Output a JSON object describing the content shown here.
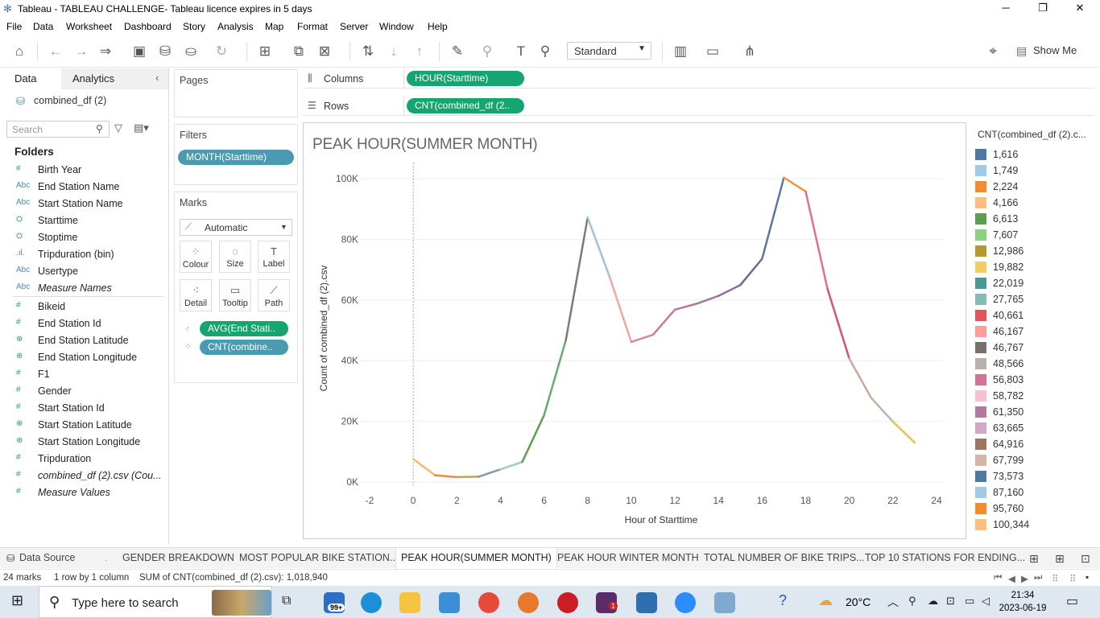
{
  "window": {
    "title": "Tableau - TABLEAU CHALLENGE- Tableau licence expires in 5 days"
  },
  "menu": [
    "File",
    "Data",
    "Worksheet",
    "Dashboard",
    "Story",
    "Analysis",
    "Map",
    "Format",
    "Server",
    "Window",
    "Help"
  ],
  "toolbar": {
    "view_select": "Standard",
    "show_me": "Show Me"
  },
  "datapane": {
    "tab_data": "Data",
    "tab_analytics": "Analytics",
    "datasource": "combined_df (2)",
    "search_placeholder": "Search",
    "folders_label": "Folders",
    "dimensions": [
      {
        "icon": "#",
        "name": "Birth Year"
      },
      {
        "icon": "Abc",
        "name": "End Station Name"
      },
      {
        "icon": "Abc",
        "name": "Start Station Name"
      },
      {
        "icon": "date",
        "name": "Starttime"
      },
      {
        "icon": "date",
        "name": "Stoptime"
      },
      {
        "icon": "bin",
        "name": "Tripduration (bin)"
      },
      {
        "icon": "Abc",
        "name": "Usertype"
      },
      {
        "icon": "Abc",
        "name": "Measure Names"
      }
    ],
    "measures": [
      {
        "icon": "#",
        "name": "Bikeid"
      },
      {
        "icon": "#",
        "name": "End Station Id"
      },
      {
        "icon": "geo",
        "name": "End Station Latitude"
      },
      {
        "icon": "geo",
        "name": "End Station Longitude"
      },
      {
        "icon": "#",
        "name": "F1"
      },
      {
        "icon": "#",
        "name": "Gender"
      },
      {
        "icon": "#",
        "name": "Start Station Id"
      },
      {
        "icon": "geo",
        "name": "Start Station Latitude"
      },
      {
        "icon": "geo",
        "name": "Start Station Longitude"
      },
      {
        "icon": "#",
        "name": "Tripduration"
      },
      {
        "icon": "#",
        "name": "combined_df (2).csv (Cou..."
      },
      {
        "icon": "#",
        "name": "Measure Values"
      }
    ]
  },
  "pages_label": "Pages",
  "filters": {
    "label": "Filters",
    "pill": "MONTH(Starttime)"
  },
  "marks": {
    "label": "Marks",
    "type": "Automatic",
    "buttons": [
      "Colour",
      "Size",
      "Label",
      "Detail",
      "Tooltip",
      "Path"
    ],
    "pills": [
      "AVG(End Stati..",
      "CNT(combine.."
    ]
  },
  "shelves": {
    "columns_label": "Columns",
    "columns_pill": "HOUR(Starttime)",
    "rows_label": "Rows",
    "rows_pill": "CNT(combined_df (2.."
  },
  "chart_data": {
    "type": "line",
    "title": "PEAK HOUR(SUMMER MONTH)",
    "xlabel": "Hour of Starttime",
    "ylabel": "Count of combined_df (2).csv",
    "x_ticks": [
      "-2",
      "0",
      "2",
      "4",
      "6",
      "8",
      "10",
      "12",
      "14",
      "16",
      "18",
      "20",
      "22",
      "24"
    ],
    "y_ticks": [
      "0K",
      "20K",
      "40K",
      "60K",
      "80K",
      "100K"
    ],
    "xlim": [
      -2,
      24
    ],
    "ylim": [
      0,
      100000
    ],
    "x": [
      0,
      1,
      2,
      3,
      4,
      5,
      6,
      7,
      8,
      9,
      10,
      11,
      12,
      13,
      14,
      15,
      16,
      17,
      18,
      19,
      20,
      21,
      22,
      23
    ],
    "y": [
      7607,
      2224,
      1616,
      1749,
      4166,
      6613,
      22019,
      46767,
      87160,
      67799,
      46167,
      48566,
      56803,
      58782,
      61350,
      64916,
      73573,
      100344,
      95760,
      63665,
      40661,
      27765,
      19882,
      12986
    ],
    "segment_colors": [
      "#f5b96e",
      "#eb8f2f",
      "#c9a24a",
      "#7f9aa6",
      "#9fcdb8",
      "#5d9e4f",
      "#6aa876",
      "#7a7a7a",
      "#9fc2dd",
      "#f2a6a0",
      "#d18aa0",
      "#c77a9c",
      "#b5789a",
      "#a67aa0",
      "#8e7296",
      "#6a6a8e",
      "#5b77a6",
      "#f39440",
      "#e0708c",
      "#d6517a",
      "#c9a8a4",
      "#a8c0a0",
      "#e3c44f"
    ],
    "grid": true
  },
  "legend": {
    "title": "CNT(combined_df (2).c...",
    "items": [
      {
        "value": "1,616",
        "color": "#4e79a7"
      },
      {
        "value": "1,749",
        "color": "#a0cbe8"
      },
      {
        "value": "2,224",
        "color": "#f28e2b"
      },
      {
        "value": "4,166",
        "color": "#ffbe7d"
      },
      {
        "value": "6,613",
        "color": "#59a14f"
      },
      {
        "value": "7,607",
        "color": "#8cd17d"
      },
      {
        "value": "12,986",
        "color": "#b6992d"
      },
      {
        "value": "19,882",
        "color": "#f1ce63"
      },
      {
        "value": "22,019",
        "color": "#499894"
      },
      {
        "value": "27,765",
        "color": "#86bcb6"
      },
      {
        "value": "40,661",
        "color": "#e15759"
      },
      {
        "value": "46,167",
        "color": "#ff9d9a"
      },
      {
        "value": "46,767",
        "color": "#79706e"
      },
      {
        "value": "48,566",
        "color": "#bab0ac"
      },
      {
        "value": "56,803",
        "color": "#d37295"
      },
      {
        "value": "58,782",
        "color": "#fabfd2"
      },
      {
        "value": "61,350",
        "color": "#b07aa1"
      },
      {
        "value": "63,665",
        "color": "#d4a6c8"
      },
      {
        "value": "64,916",
        "color": "#9d7660"
      },
      {
        "value": "67,799",
        "color": "#d7b5a6"
      },
      {
        "value": "73,573",
        "color": "#4e79a7"
      },
      {
        "value": "87,160",
        "color": "#a0cbe8"
      },
      {
        "value": "95,760",
        "color": "#f28e2b"
      },
      {
        "value": "100,344",
        "color": "#ffbe7d"
      }
    ]
  },
  "sheet_tabs": {
    "data_source": "Data Source",
    "tabs": [
      "GENDER BREAKDOWN",
      "MOST POPULAR BIKE STATION...",
      "PEAK HOUR(SUMMER MONTH)",
      "PEAK HOUR WINTER MONTH",
      "TOTAL NUMBER OF BIKE TRIPS...",
      "TOP 10 STATIONS FOR ENDING..."
    ],
    "active": "PEAK HOUR(SUMMER MONTH)"
  },
  "status": {
    "marks": "24 marks",
    "dims": "1 row by 1 column",
    "sum": "SUM of CNT(combined_df (2).csv): 1,018,940"
  },
  "taskbar": {
    "search_placeholder": "Type here to search",
    "mail_badge": "99+",
    "slack_badge": "1",
    "weather": "20°C",
    "time": "21:34",
    "date": "2023-06-19"
  }
}
